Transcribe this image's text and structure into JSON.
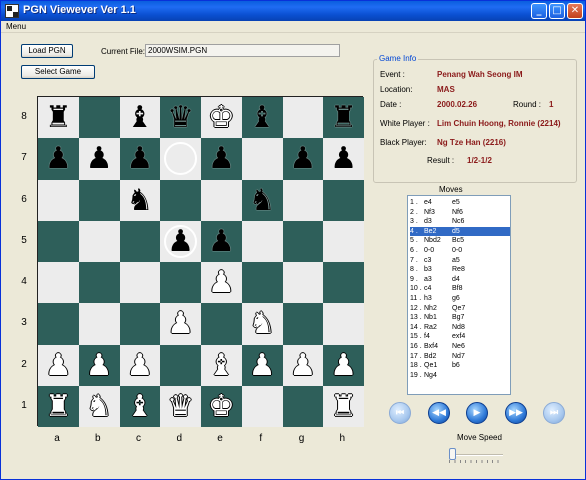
{
  "window": {
    "title": "PGN Viewever Ver 1.1"
  },
  "menu": {
    "items": [
      "Menu"
    ]
  },
  "toolbar": {
    "load_label": "Load PGN",
    "select_label": "Select Game",
    "current_file_label": "Current File:",
    "current_file_value": "2000WSIM.PGN"
  },
  "board": {
    "rank_labels": [
      "8",
      "7",
      "6",
      "5",
      "4",
      "3",
      "2",
      "1"
    ],
    "file_labels": [
      "a",
      "b",
      "c",
      "d",
      "e",
      "f",
      "g",
      "h"
    ],
    "pieces": [
      [
        "br",
        null,
        "bb",
        "bq",
        "wk",
        "bb",
        null,
        "br"
      ],
      [
        "bp",
        "bp",
        "bp",
        "ring",
        "bp",
        null,
        "bp",
        "bp"
      ],
      [
        null,
        null,
        "bn",
        null,
        null,
        "bn",
        null,
        null
      ],
      [
        null,
        null,
        null,
        "bp_ring",
        "bp",
        null,
        null,
        null
      ],
      [
        null,
        null,
        null,
        null,
        "wp",
        null,
        null,
        null
      ],
      [
        null,
        null,
        null,
        "wp",
        null,
        "wn",
        null,
        null
      ],
      [
        "wp",
        "wp",
        "wp",
        null,
        "wb",
        "wp",
        "wp",
        "wp"
      ],
      [
        "wr",
        "wn",
        "wb",
        "wq",
        "wk",
        null,
        null,
        "wr"
      ]
    ]
  },
  "game_info": {
    "title": "Game Info",
    "event_label": "Event :",
    "event": "Penang Wah Seong IM",
    "location_label": "Location:",
    "location": "MAS",
    "date_label": "Date :",
    "date": "2000.02.26",
    "round_label": "Round :",
    "round": "1",
    "white_label": "White Player :",
    "white": "Lim Chuin Hoong, Ronnie  (2214)",
    "black_label": "Black Player:",
    "black": "Ng Tze Han  (2216)",
    "result_label": "Result :",
    "result": "1/2-1/2"
  },
  "moves": {
    "title": "Moves",
    "selected_index": 3,
    "list": [
      [
        "1 .",
        "e4",
        "e5"
      ],
      [
        "2 .",
        "Nf3",
        "Nf6"
      ],
      [
        "3 .",
        "d3",
        "Nc6"
      ],
      [
        "4 .",
        "Be2",
        "d5"
      ],
      [
        "5 .",
        "Nbd2",
        "Bc5"
      ],
      [
        "6 .",
        "0-0",
        "0-0"
      ],
      [
        "7 .",
        "c3",
        "a5"
      ],
      [
        "8 .",
        "b3",
        "Re8"
      ],
      [
        "9 .",
        "a3",
        "d4"
      ],
      [
        "10 .",
        "c4",
        "Bf8"
      ],
      [
        "11 .",
        "h3",
        "g6"
      ],
      [
        "12 .",
        "Nh2",
        "Qe7"
      ],
      [
        "13 .",
        "Nb1",
        "Bg7"
      ],
      [
        "14 .",
        "Ra2",
        "Nd8"
      ],
      [
        "15 .",
        "f4",
        "exf4"
      ],
      [
        "16 .",
        "Bxf4",
        "Ne6"
      ],
      [
        "17 .",
        "Bd2",
        "Nd7"
      ],
      [
        "18 .",
        "Qe1",
        "b6"
      ],
      [
        "19 .",
        "Ng4",
        ""
      ]
    ]
  },
  "navigation": {
    "first_icon": "first-icon",
    "prev_icon": "prev-icon",
    "play_icon": "play-icon",
    "next_icon": "next-icon",
    "last_icon": "last-icon"
  },
  "speed": {
    "label": "Move Speed",
    "value": 0.0
  },
  "colors": {
    "light_square": "#ececec",
    "dark_square": "#2e5f5a",
    "info_value": "#8b1a1a",
    "selection": "#316ac5"
  }
}
